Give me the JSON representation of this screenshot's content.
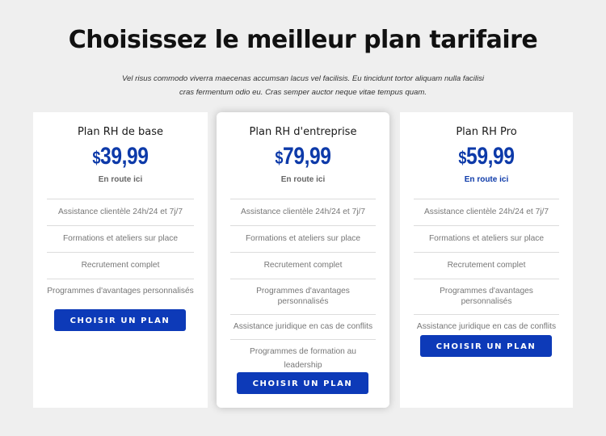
{
  "header": {
    "title": "Choisissez le meilleur plan tarifaire",
    "subtitle": "Vel risus commodo viverra maecenas accumsan lacus vel facilisis. Eu tincidunt tortor aliquam nulla facilisi cras fermentum odio eu. Cras semper auctor neque vitae tempus quam."
  },
  "colors": {
    "accent": "#0d3ab8",
    "price": "#0d3aa9",
    "background": "#efefef"
  },
  "plans": [
    {
      "name": "Plan RH de base",
      "currency": "$",
      "price": "39,99",
      "tagline": "En route ici",
      "features": [
        "Assistance clientèle 24h/24 et 7j/7",
        "Formations et ateliers sur place",
        "Recrutement complet",
        "Programmes d'avantages personnalisés"
      ],
      "button": "CHOISIR UN PLAN"
    },
    {
      "name": "Plan RH d'entreprise",
      "currency": "$",
      "price": "79,99",
      "tagline": "En route ici",
      "features": [
        "Assistance clientèle 24h/24 et 7j/7",
        "Formations et ateliers sur place",
        "Recrutement complet",
        "Programmes d'avantages personnalisés",
        "Assistance juridique en cas de conflits",
        "Programmes de formation au leadership"
      ],
      "button": "CHOISIR UN PLAN"
    },
    {
      "name": "Plan RH Pro",
      "currency": "$",
      "price": "59,99",
      "tagline": "En route ici",
      "features": [
        "Assistance clientèle 24h/24 et 7j/7",
        "Formations et ateliers sur place",
        "Recrutement complet",
        "Programmes d'avantages personnalisés",
        "Assistance juridique en cas de conflits"
      ],
      "button": "CHOISIR UN PLAN"
    }
  ]
}
